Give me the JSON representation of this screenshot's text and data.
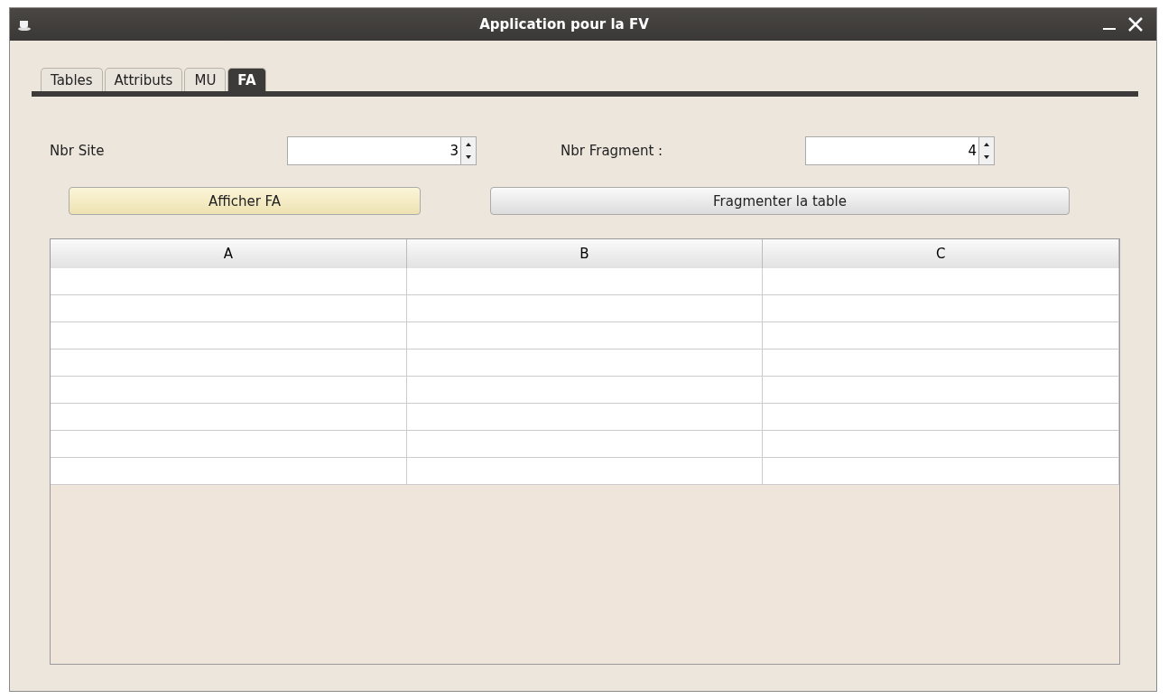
{
  "window": {
    "title": "Application pour la FV"
  },
  "tabs": [
    {
      "label": "Tables",
      "selected": false
    },
    {
      "label": "Attributs",
      "selected": false
    },
    {
      "label": "MU",
      "selected": false
    },
    {
      "label": "FA",
      "selected": true
    }
  ],
  "fields": [
    {
      "label": "Nbr Site",
      "value": "3"
    },
    {
      "label": "Nbr Fragment :",
      "value": "4"
    }
  ],
  "buttons": [
    {
      "label": "Afficher FA",
      "focused": true
    },
    {
      "label": "Fragmenter la table",
      "focused": false
    }
  ],
  "table": {
    "columns": [
      "A",
      "B",
      "C"
    ]
  }
}
